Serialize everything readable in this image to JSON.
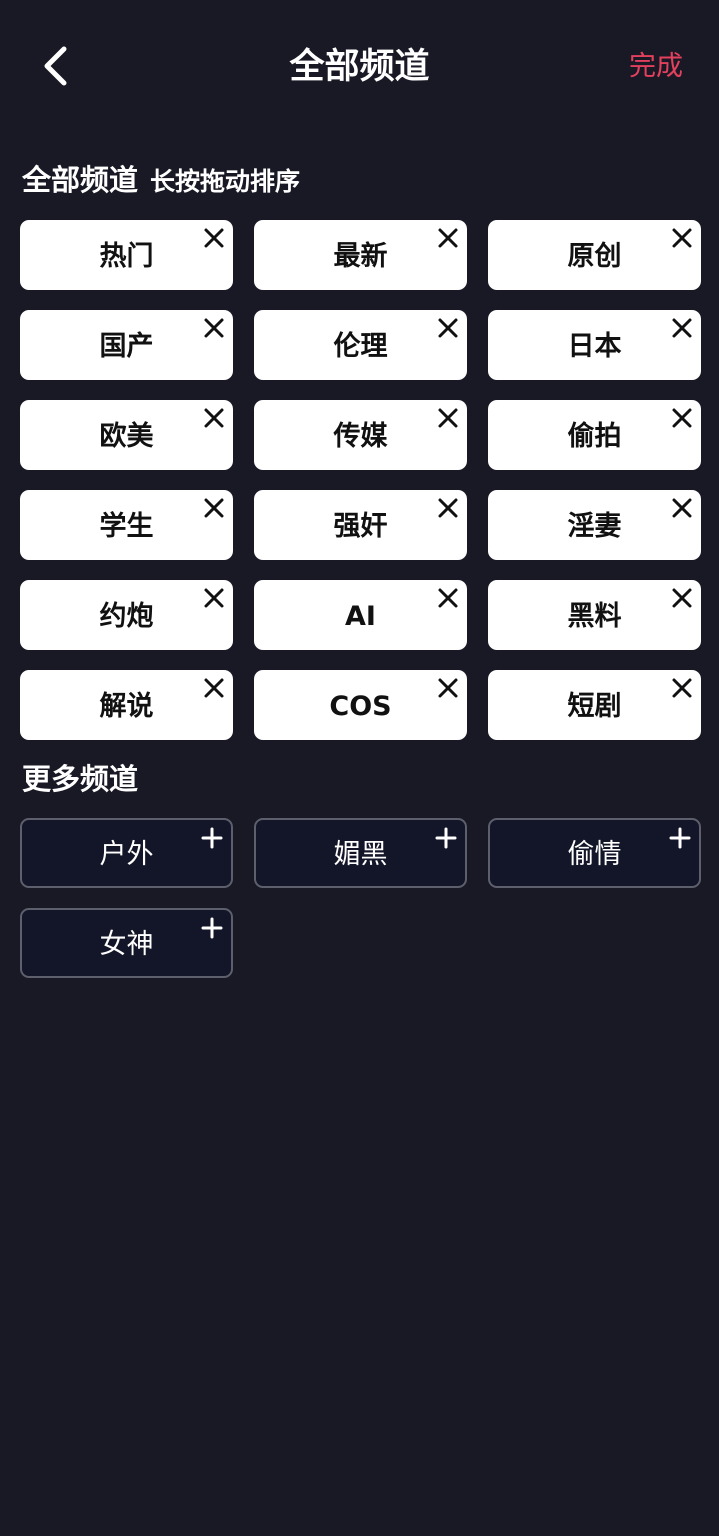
{
  "header": {
    "title": "全部频道",
    "done_label": "完成",
    "back_icon": "chevron-left-icon"
  },
  "colors": {
    "background": "#191926",
    "accent": "#e3405e",
    "chip_active_bg": "#ffffff",
    "chip_inactive_bg": "#131628",
    "chip_inactive_border": "#5d5f6c"
  },
  "my_channels": {
    "title": "全部频道",
    "hint": "长按拖动排序",
    "remove_icon": "close-icon",
    "items": [
      "热门",
      "最新",
      "原创",
      "国产",
      "伦理",
      "日本",
      "欧美",
      "传媒",
      "偷拍",
      "学生",
      "强奸",
      "淫妻",
      "约炮",
      "AI",
      "黑料",
      "解说",
      "COS",
      "短剧"
    ]
  },
  "more_channels": {
    "title": "更多频道",
    "add_icon": "plus-icon",
    "items": [
      "户外",
      "媚黑",
      "偷情",
      "女神"
    ]
  }
}
